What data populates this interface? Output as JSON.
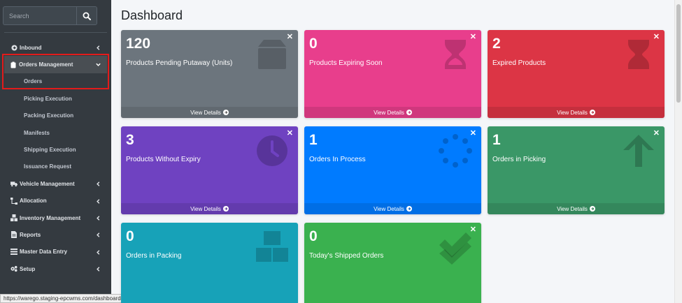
{
  "sidebar": {
    "search_placeholder": "Search",
    "items": [
      {
        "label": "Inbound",
        "icon": "circle-arrow-icon",
        "expanded": false
      },
      {
        "label": "Orders Management",
        "icon": "clipboard-icon",
        "expanded": true
      },
      {
        "label": "Orders"
      },
      {
        "label": "Picking Execution"
      },
      {
        "label": "Packing Execution"
      },
      {
        "label": "Manifests"
      },
      {
        "label": "Shipping Execution"
      },
      {
        "label": "Issuance Request"
      },
      {
        "label": "Vehicle Management",
        "icon": "truck-icon",
        "expanded": false
      },
      {
        "label": "Allocation",
        "icon": "sitemap-icon",
        "expanded": false
      },
      {
        "label": "Inventory Management",
        "icon": "boxes-icon",
        "expanded": false
      },
      {
        "label": "Reports",
        "icon": "file-icon",
        "expanded": false
      },
      {
        "label": "Master Data Entry",
        "icon": "list-icon",
        "expanded": false
      },
      {
        "label": "Setup",
        "icon": "cogs-icon",
        "expanded": false
      }
    ]
  },
  "status_url": "https://warego.staging-epcwms.com/dashboard#",
  "main": {
    "title": "Dashboard",
    "cards": [
      {
        "value": "120",
        "label": "Products Pending Putaway (Units)",
        "footer": "View Details",
        "color": "#6c757d",
        "icon": "box-icon"
      },
      {
        "value": "0",
        "label": "Products Expiring Soon",
        "footer": "View Details",
        "color": "#e83e8c",
        "icon": "hourglass-icon"
      },
      {
        "value": "2",
        "label": "Expired Products",
        "footer": "View Details",
        "color": "#dc3545",
        "icon": "hourglass-full-icon"
      },
      {
        "value": "3",
        "label": "Products Without Expiry",
        "footer": "View Details",
        "color": "#6f42c1",
        "icon": "clock-icon"
      },
      {
        "value": "1",
        "label": "Orders In Process",
        "footer": "View Details",
        "color": "#007bff",
        "icon": "spinner-icon"
      },
      {
        "value": "1",
        "label": "Orders in Picking",
        "footer": "View Details",
        "color": "#28a745",
        "icon": "arrow-up-icon"
      },
      {
        "value": "0",
        "label": "Orders in Packing",
        "footer": "",
        "color": "#17a2b8",
        "icon": "boxes-icon"
      },
      {
        "value": "0",
        "label": "Today's Shipped Orders",
        "footer": "",
        "color": "#28a745",
        "icon": "check-double-icon"
      }
    ]
  }
}
